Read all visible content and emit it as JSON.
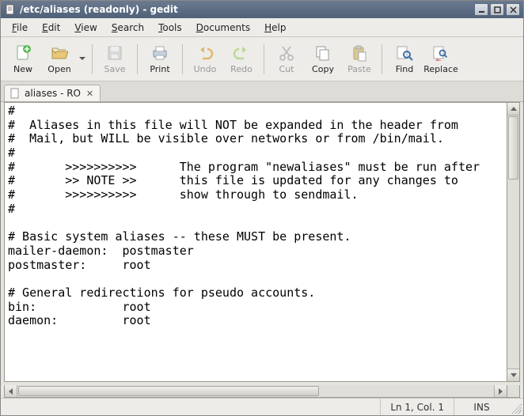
{
  "window": {
    "title": "/etc/aliases (readonly) - gedit"
  },
  "menubar": [
    {
      "label": "File",
      "accel": "F"
    },
    {
      "label": "Edit",
      "accel": "E"
    },
    {
      "label": "View",
      "accel": "V"
    },
    {
      "label": "Search",
      "accel": "S"
    },
    {
      "label": "Tools",
      "accel": "T"
    },
    {
      "label": "Documents",
      "accel": "D"
    },
    {
      "label": "Help",
      "accel": "H"
    }
  ],
  "toolbar": {
    "new": "New",
    "open": "Open",
    "save": "Save",
    "print": "Print",
    "undo": "Undo",
    "redo": "Redo",
    "cut": "Cut",
    "copy": "Copy",
    "paste": "Paste",
    "find": "Find",
    "replace": "Replace"
  },
  "tabs": [
    {
      "label": "aliases - RO"
    }
  ],
  "editor": {
    "content": "#\n#  Aliases in this file will NOT be expanded in the header from\n#  Mail, but WILL be visible over networks or from /bin/mail.\n#\n#       >>>>>>>>>>      The program \"newaliases\" must be run after\n#       >> NOTE >>      this file is updated for any changes to\n#       >>>>>>>>>>      show through to sendmail.\n#\n\n# Basic system aliases -- these MUST be present.\nmailer-daemon:  postmaster\npostmaster:     root\n\n# General redirections for pseudo accounts.\nbin:            root\ndaemon:         root"
  },
  "statusbar": {
    "position": "Ln 1, Col. 1",
    "mode": "INS"
  }
}
